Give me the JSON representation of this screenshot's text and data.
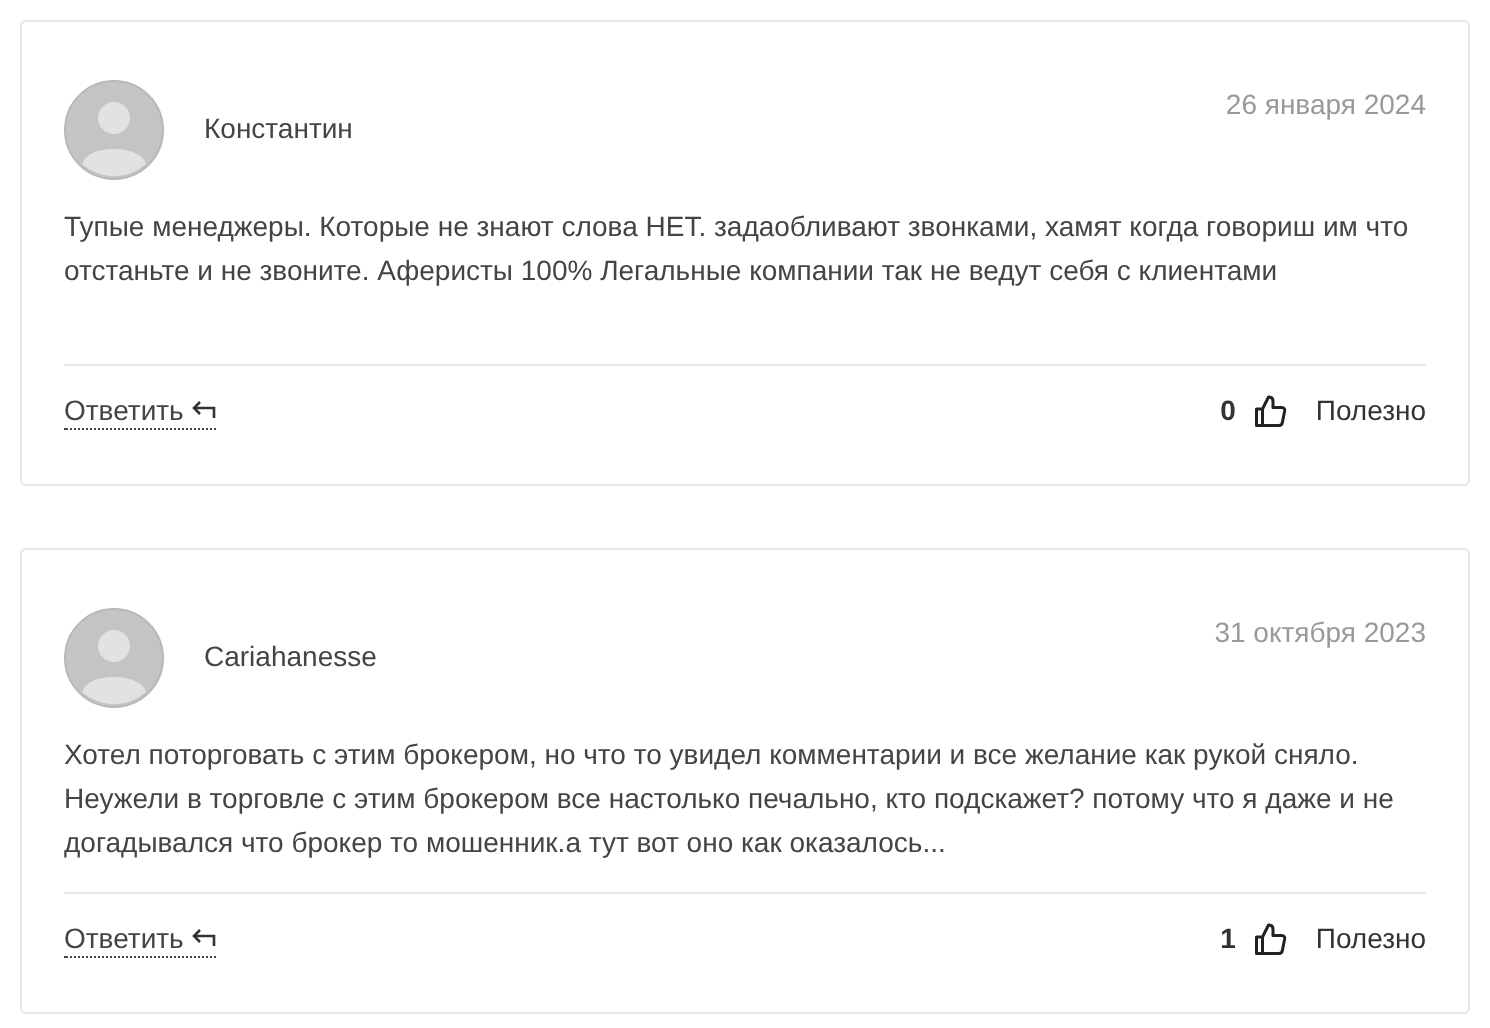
{
  "comments": [
    {
      "author": "Константин",
      "date": "26 января 2024",
      "text": "Тупые менеджеры. Которые не знают слова НЕТ. задаобливают звонками, хамят когда говориш им что отстаньте и не звоните. Аферисты 100% Легальные компании так не ведут себя с клиентами",
      "reply": "Ответить",
      "likes": "0",
      "helpful": "Полезно"
    },
    {
      "author": "Cariahanesse",
      "date": "31 октября 2023",
      "text": "Хотел поторговать с этим брокером, но что то увидел комментарии и все желание как рукой сняло. Неужели в торговле с этим брокером все настолько печально, кто подскажет? потому что я даже и не догадывался что брокер то мошенник.а тут вот оно как оказалось...",
      "reply": "Ответить",
      "likes": "1",
      "helpful": "Полезно"
    }
  ]
}
